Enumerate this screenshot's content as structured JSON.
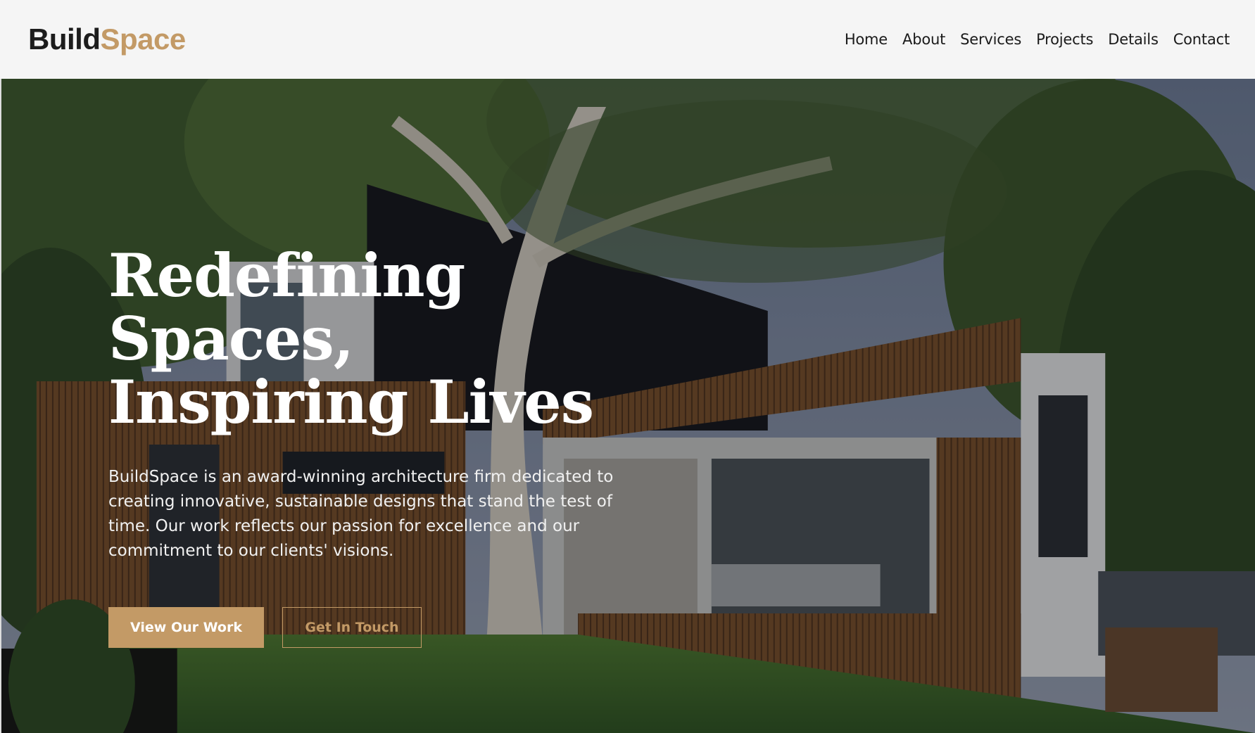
{
  "brand": {
    "name_dark": "Build",
    "name_accent": "Space",
    "accent_color": "#c39a66"
  },
  "nav": {
    "items": [
      {
        "label": "Home"
      },
      {
        "label": "About"
      },
      {
        "label": "Services"
      },
      {
        "label": "Projects"
      },
      {
        "label": "Details"
      },
      {
        "label": "Contact"
      }
    ]
  },
  "hero": {
    "title_line1": "Redefining Spaces,",
    "title_line2": "Inspiring Lives",
    "description": "BuildSpace is an award-winning architecture firm dedicated to creating innovative, sustainable designs that stand the test of time. Our work reflects our passion for excellence and our commitment to our clients' visions.",
    "primary_button": "View Our Work",
    "secondary_button": "Get In Touch"
  }
}
